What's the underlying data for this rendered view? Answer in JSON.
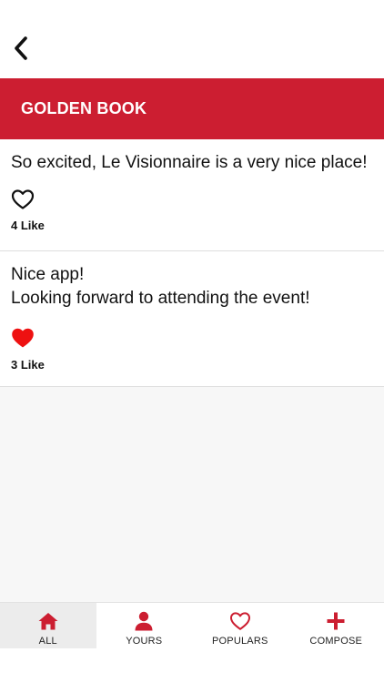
{
  "header": {
    "back_icon": "chevron-left-icon"
  },
  "section": {
    "title": "GOLDEN BOOK",
    "color": "#cc1e31"
  },
  "posts": [
    {
      "text": "So excited, Le Visionnaire is a very nice place!",
      "liked": false,
      "likes_label": "4 Like"
    },
    {
      "text": "Nice app!\nLooking forward to attending the event!",
      "liked": true,
      "likes_label": "3 Like"
    }
  ],
  "tabs": [
    {
      "label": "ALL",
      "icon": "home-icon",
      "active": true
    },
    {
      "label": "YOURS",
      "icon": "user-icon",
      "active": false
    },
    {
      "label": "POPULARS",
      "icon": "heart-outline-icon",
      "active": false
    },
    {
      "label": "COMPOSE",
      "icon": "plus-icon",
      "active": false
    }
  ],
  "colors": {
    "accent": "#cc1e31",
    "like_filled": "#ee1111"
  }
}
